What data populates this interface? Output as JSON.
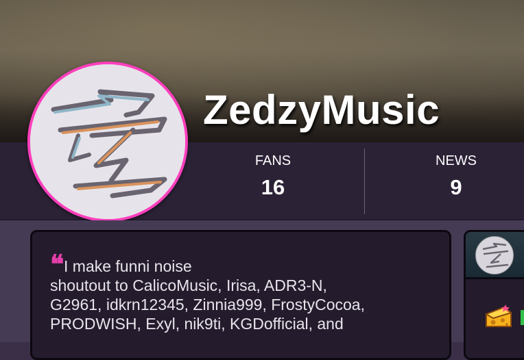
{
  "profile": {
    "username": "ZedzyMusic"
  },
  "stats": {
    "fans_label": "FANS",
    "fans_value": "16",
    "news_label": "NEWS",
    "news_value": "9"
  },
  "bio": {
    "lines": [
      "I make funni noise",
      "shoutout to CalicoMusic, Irisa, ADR3-N,",
      "G2961, idkrn12345, Zinnia999, FrostyCocoa,",
      "PRODWISH, Exyl, nik9ti, KGDofficial, and"
    ]
  },
  "colors": {
    "accent_pink": "#ff3fbd",
    "quote_pink": "#e33ea9",
    "stats_bg": "#2c2236",
    "card_bg": "#241b2c",
    "page_bg": "#463b54"
  },
  "icons": {
    "avatar": "zedzy-logo-drawing",
    "side_badge": "cheese-icon"
  }
}
